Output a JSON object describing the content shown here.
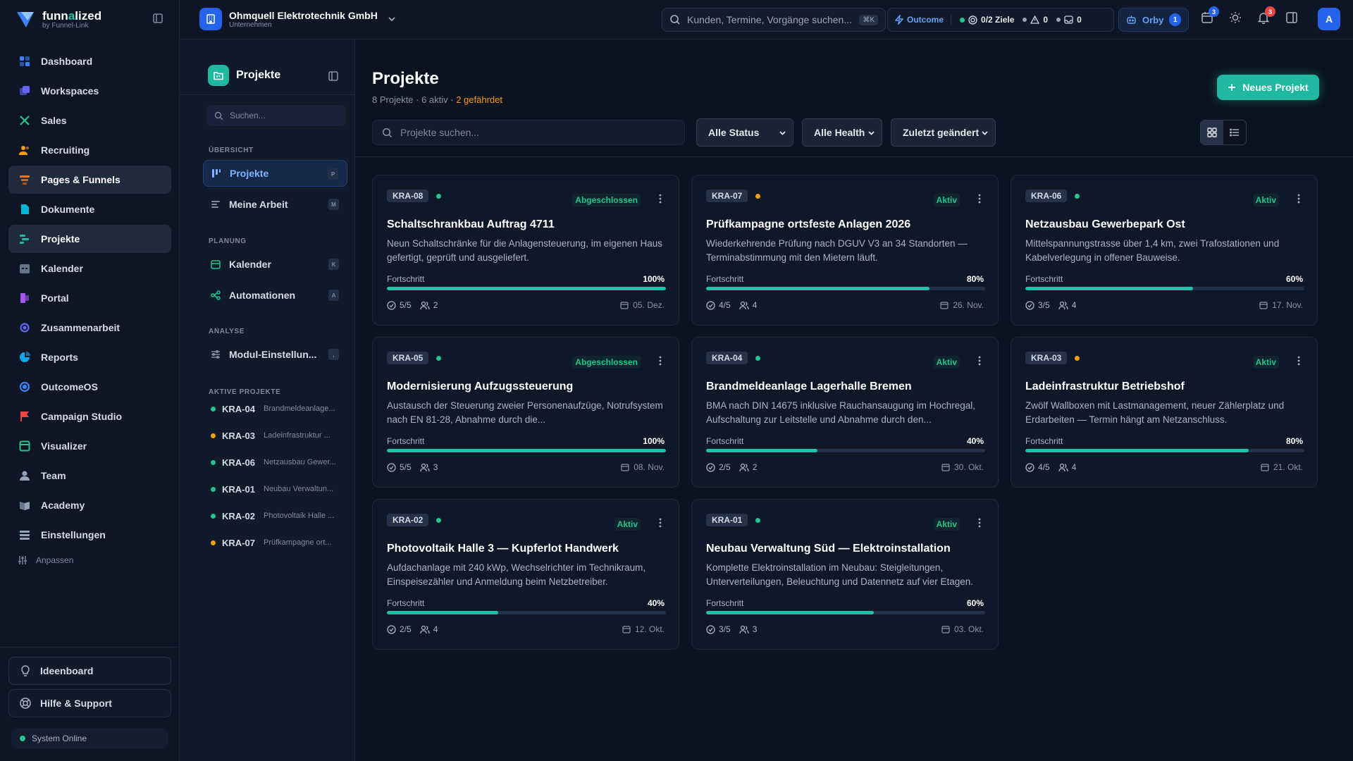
{
  "brand": {
    "name_prefix": "funn",
    "name_accent": "a",
    "name_suffix": "lized",
    "sub": "by Funnel-Link"
  },
  "nav": [
    {
      "label": "Dashboard",
      "icon": "dashboard-icon",
      "color": "#3b82f6"
    },
    {
      "label": "Workspaces",
      "icon": "workspaces-icon",
      "color": "#6366f1"
    },
    {
      "label": "Sales",
      "icon": "sales-icon",
      "color": "#22c58b"
    },
    {
      "label": "Recruiting",
      "icon": "recruiting-icon",
      "color": "#f59e0b"
    },
    {
      "label": "Pages & Funnels",
      "icon": "funnel-icon",
      "color": "#f97316",
      "active": true
    },
    {
      "label": "Dokumente",
      "icon": "document-icon",
      "color": "#06b6d4"
    },
    {
      "label": "Projekte",
      "icon": "projects-icon",
      "color": "#1fb8a0",
      "active": true
    },
    {
      "label": "Kalender",
      "icon": "calendar-icon",
      "color": "#64748b"
    },
    {
      "label": "Portal",
      "icon": "portal-icon",
      "color": "#a855f7"
    },
    {
      "label": "Zusammenarbeit",
      "icon": "collaboration-icon",
      "color": "#6366f1"
    },
    {
      "label": "Reports",
      "icon": "reports-icon",
      "color": "#0ea5e9"
    },
    {
      "label": "OutcomeOS",
      "icon": "outcome-icon",
      "color": "#3b82f6"
    },
    {
      "label": "Campaign Studio",
      "icon": "flag-icon",
      "color": "#ef4444"
    },
    {
      "label": "Visualizer",
      "icon": "visualizer-icon",
      "color": "#22c58b"
    },
    {
      "label": "Team",
      "icon": "team-icon",
      "color": "#94a3b8"
    },
    {
      "label": "Academy",
      "icon": "academy-icon",
      "color": "#94a3b8"
    },
    {
      "label": "Einstellungen",
      "icon": "settings-icon",
      "color": "#94a3b8"
    }
  ],
  "customize_label": "Anpassen",
  "ideaboard_label": "Ideenboard",
  "help_label": "Hilfe & Support",
  "system_status": "System Online",
  "company": {
    "name": "Ohmquell Elektrotechnik GmbH",
    "kind": "Unternehmen"
  },
  "global_search": {
    "placeholder": "Kunden, Termine, Vorgänge suchen...",
    "shortcut": "⌘K"
  },
  "stats": {
    "outcome_label": "Outcome",
    "goals": "0/2 Ziele",
    "alerts": "0",
    "messages": "0"
  },
  "orby": {
    "label": "Orby",
    "count": "1"
  },
  "topbar_badges": {
    "calendar": "3",
    "notifications": "3"
  },
  "avatar_initial": "A",
  "panel": {
    "title": "Projekte",
    "search_placeholder": "Suchen...",
    "sections": {
      "overview": "ÜBERSICHT",
      "planning": "PLANUNG",
      "analysis": "ANALYSE",
      "active": "AKTIVE PROJEKTE"
    },
    "items": [
      {
        "label": "Projekte",
        "key": "P"
      },
      {
        "label": "Meine Arbeit",
        "key": "M"
      },
      {
        "label": "Kalender",
        "key": "K"
      },
      {
        "label": "Automationen",
        "key": "A"
      },
      {
        "label": "Modul-Einstellun...",
        "key": ","
      }
    ],
    "active_projects": [
      {
        "code": "KRA-04",
        "name": "Brandmeldeanlage...",
        "color": "#22c58b"
      },
      {
        "code": "KRA-03",
        "name": "Ladeinfrastruktur ...",
        "color": "#f59e0b"
      },
      {
        "code": "KRA-06",
        "name": "Netzausbau Gewer...",
        "color": "#22c58b"
      },
      {
        "code": "KRA-01",
        "name": "Neubau Verwaltun...",
        "color": "#22c58b"
      },
      {
        "code": "KRA-02",
        "name": "Photovoltaik Halle ...",
        "color": "#22c58b"
      },
      {
        "code": "KRA-07",
        "name": "Prüfkampagne ort...",
        "color": "#f59e0b"
      }
    ]
  },
  "main": {
    "title": "Projekte",
    "subtitle": "8 Projekte · 6 aktiv · ",
    "subtitle_warn": "2 gefährdet",
    "new_button": "Neues Projekt",
    "search_placeholder": "Projekte suchen...",
    "filters": {
      "status": "Alle Status",
      "health": "Alle Health",
      "sort": "Zuletzt geändert"
    },
    "progress_label": "Fortschritt"
  },
  "projects": [
    {
      "code": "KRA-08",
      "dot": "#22c58b",
      "status": "Abgeschlossen",
      "title": "Schaltschrankbau Auftrag 4711",
      "desc": "Neun Schaltschränke für die Anlagensteuerung, im eigenen Haus gefertigt, geprüft und ausgeliefert.",
      "progress": 100,
      "progress_label": "100%",
      "tasks": "5/5",
      "members": "2",
      "date": "05. Dez."
    },
    {
      "code": "KRA-07",
      "dot": "#f59e0b",
      "status": "Aktiv",
      "title": "Prüfkampagne ortsfeste Anlagen 2026",
      "desc": "Wiederkehrende Prüfung nach DGUV V3 an 34 Standorten — Terminabstimmung mit den Mietern läuft.",
      "progress": 80,
      "progress_label": "80%",
      "tasks": "4/5",
      "members": "4",
      "date": "26. Nov."
    },
    {
      "code": "KRA-06",
      "dot": "#22c58b",
      "status": "Aktiv",
      "title": "Netzausbau Gewerbepark Ost",
      "desc": "Mittelspannungstrasse über 1,4 km, zwei Trafostationen und Kabelverlegung in offener Bauweise.",
      "progress": 60,
      "progress_label": "60%",
      "tasks": "3/5",
      "members": "4",
      "date": "17. Nov."
    },
    {
      "code": "KRA-05",
      "dot": "#22c58b",
      "status": "Abgeschlossen",
      "title": "Modernisierung Aufzugssteuerung",
      "desc": "Austausch der Steuerung zweier Personenaufzüge, Notrufsystem nach EN 81-28, Abnahme durch die...",
      "progress": 100,
      "progress_label": "100%",
      "tasks": "5/5",
      "members": "3",
      "date": "08. Nov."
    },
    {
      "code": "KRA-04",
      "dot": "#22c58b",
      "status": "Aktiv",
      "title": "Brandmeldeanlage Lagerhalle Bremen",
      "desc": "BMA nach DIN 14675 inklusive Rauchansaugung im Hochregal, Aufschaltung zur Leitstelle und Abnahme durch den...",
      "progress": 40,
      "progress_label": "40%",
      "tasks": "2/5",
      "members": "2",
      "date": "30. Okt."
    },
    {
      "code": "KRA-03",
      "dot": "#f59e0b",
      "status": "Aktiv",
      "title": "Ladeinfrastruktur Betriebshof",
      "desc": "Zwölf Wallboxen mit Lastmanagement, neuer Zählerplatz und Erdarbeiten — Termin hängt am Netzanschluss.",
      "progress": 80,
      "progress_label": "80%",
      "tasks": "4/5",
      "members": "4",
      "date": "21. Okt."
    },
    {
      "code": "KRA-02",
      "dot": "#22c58b",
      "status": "Aktiv",
      "title": "Photovoltaik Halle 3 — Kupferlot Handwerk",
      "desc": "Aufdachanlage mit 240 kWp, Wechselrichter im Technikraum, Einspeisezähler und Anmeldung beim Netzbetreiber.",
      "progress": 40,
      "progress_label": "40%",
      "tasks": "2/5",
      "members": "4",
      "date": "12. Okt."
    },
    {
      "code": "KRA-01",
      "dot": "#22c58b",
      "status": "Aktiv",
      "title": "Neubau Verwaltung Süd — Elektroinstallation",
      "desc": "Komplette Elektroinstallation im Neubau: Steigleitungen, Unterverteilungen, Beleuchtung und Datennetz auf vier Etagen.",
      "progress": 60,
      "progress_label": "60%",
      "tasks": "3/5",
      "members": "3",
      "date": "03. Okt."
    }
  ]
}
